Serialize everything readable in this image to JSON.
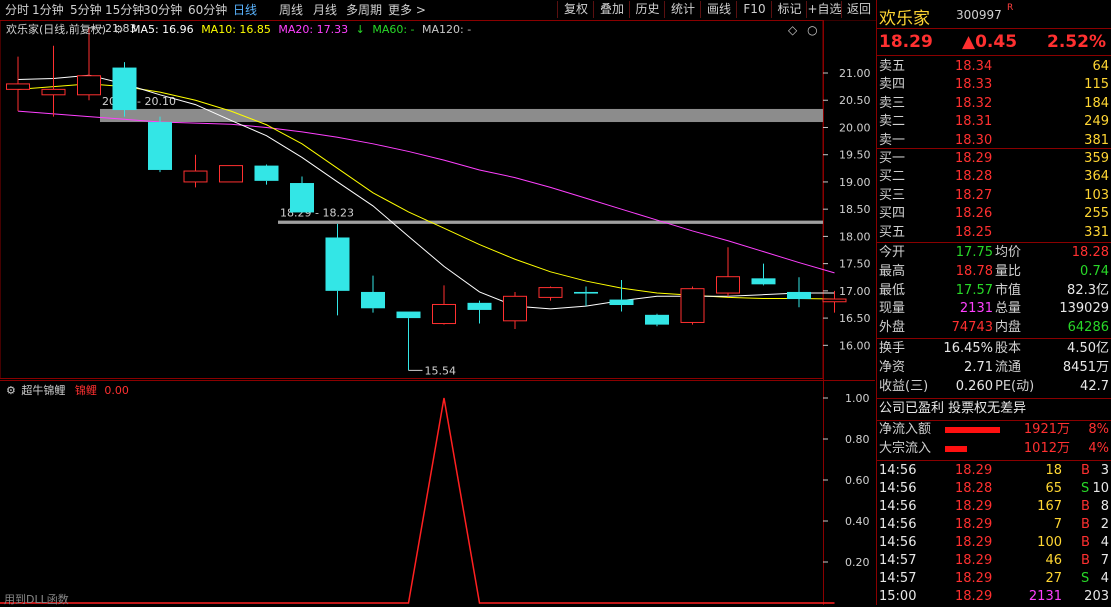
{
  "toolbar": {
    "periods": [
      "分时",
      "1分钟",
      "5分钟",
      "15分钟",
      "30分钟",
      "60分钟",
      "日线",
      "周线",
      "月线",
      "多周期",
      "更多 >"
    ],
    "active_index": 6,
    "actions": [
      "复权",
      "叠加",
      "历史",
      "统计",
      "画线",
      "F10",
      "标记",
      "+自选",
      "返回"
    ]
  },
  "header": {
    "stock_label": "欢乐家(日线,前复权)",
    "ma5": "MA5: 16.96",
    "ma10": "MA10: 16.85",
    "ma20": "MA20: 17.33",
    "ma60": "MA60: -",
    "ma120": "MA120: -",
    "colors": {
      "ma5": "#ffffff",
      "ma10": "#ffff00",
      "ma20": "#ff40ff",
      "ma60": "#28d828",
      "ma120": "#c8c8c8"
    }
  },
  "indicator": {
    "name": "超牛锦鲤",
    "series_label": "锦鲤",
    "value": "0.00",
    "footer": "用到DLL函数"
  },
  "chart_data": [
    {
      "type": "candlestick",
      "y_axis_ticks": [
        21.0,
        20.5,
        20.0,
        19.5,
        19.0,
        18.5,
        18.0,
        17.5,
        17.0,
        16.5,
        16.0
      ],
      "ylim": [
        15.4,
        21.9
      ],
      "candles": [
        {
          "o": 20.7,
          "c": 20.8,
          "h": 21.3,
          "l": 20.3
        },
        {
          "o": 20.6,
          "c": 20.7,
          "h": 21.5,
          "l": 20.2
        },
        {
          "o": 20.6,
          "c": 20.95,
          "h": 21.83,
          "l": 20.5
        },
        {
          "o": 21.1,
          "c": 20.32,
          "h": 21.2,
          "l": 20.2
        },
        {
          "o": 20.1,
          "c": 19.22,
          "h": 20.2,
          "l": 19.18
        },
        {
          "o": 19.0,
          "c": 19.2,
          "h": 19.5,
          "l": 18.9
        },
        {
          "o": 19.0,
          "c": 19.3,
          "h": 19.3,
          "l": 19.0
        },
        {
          "o": 19.3,
          "c": 19.02,
          "h": 19.32,
          "l": 18.95
        },
        {
          "o": 18.98,
          "c": 18.44,
          "h": 19.1,
          "l": 18.44
        },
        {
          "o": 17.98,
          "c": 17.0,
          "h": 18.23,
          "l": 16.55
        },
        {
          "o": 16.98,
          "c": 16.68,
          "h": 17.28,
          "l": 16.6
        },
        {
          "o": 16.62,
          "c": 16.5,
          "h": 16.62,
          "l": 15.54
        },
        {
          "o": 16.4,
          "c": 16.75,
          "h": 17.1,
          "l": 16.38
        },
        {
          "o": 16.78,
          "c": 16.65,
          "h": 16.82,
          "l": 16.4
        },
        {
          "o": 16.45,
          "c": 16.9,
          "h": 16.98,
          "l": 16.3
        },
        {
          "o": 16.88,
          "c": 17.06,
          "h": 17.08,
          "l": 16.82
        },
        {
          "o": 16.98,
          "c": 16.95,
          "h": 17.08,
          "l": 16.72
        },
        {
          "o": 16.84,
          "c": 16.74,
          "h": 17.2,
          "l": 16.62
        },
        {
          "o": 16.56,
          "c": 16.38,
          "h": 16.58,
          "l": 16.35
        },
        {
          "o": 16.42,
          "c": 17.04,
          "h": 17.08,
          "l": 16.38
        },
        {
          "o": 16.96,
          "c": 17.26,
          "h": 17.8,
          "l": 16.9
        },
        {
          "o": 17.23,
          "c": 17.12,
          "h": 17.5,
          "l": 17.1
        },
        {
          "o": 16.98,
          "c": 16.85,
          "h": 17.25,
          "l": 16.7
        },
        {
          "o": 16.8,
          "c": 16.85,
          "h": 17.0,
          "l": 16.6
        }
      ],
      "ma5": [
        20.88,
        20.9,
        20.96,
        20.8,
        20.6,
        20.42,
        20.13,
        19.85,
        19.45,
        19.0,
        18.56,
        18.0,
        17.45,
        16.98,
        16.72,
        16.67,
        16.72,
        16.82,
        16.9,
        16.9,
        16.9,
        16.93,
        16.96,
        16.96
      ],
      "ma10": [
        20.7,
        20.75,
        20.8,
        20.75,
        20.65,
        20.5,
        20.3,
        20.05,
        19.7,
        19.25,
        18.8,
        18.45,
        18.15,
        17.85,
        17.58,
        17.35,
        17.18,
        17.05,
        16.96,
        16.92,
        16.88,
        16.86,
        16.86,
        16.85
      ],
      "ma20": [
        20.3,
        20.25,
        20.2,
        20.15,
        20.1,
        20.08,
        20.06,
        20.0,
        19.92,
        19.82,
        19.7,
        19.56,
        19.4,
        19.22,
        19.08,
        18.9,
        18.7,
        18.5,
        18.3,
        18.1,
        17.92,
        17.72,
        17.52,
        17.33
      ],
      "price_levels": [
        {
          "label": "20.34 - 20.10",
          "low": 20.1,
          "high": 20.34
        },
        {
          "label": "18.29 - 18.23",
          "low": 18.23,
          "high": 18.29
        }
      ],
      "annotations": {
        "high": "21.83",
        "low": "15.54"
      }
    },
    {
      "type": "line",
      "y_axis_ticks": [
        1.0,
        0.8,
        0.6,
        0.4,
        0.2
      ],
      "ylim": [
        0,
        1
      ],
      "values": [
        0,
        0,
        0,
        0,
        0,
        0,
        0,
        0,
        0,
        0,
        0,
        0,
        1,
        0,
        0,
        0,
        0,
        0,
        0,
        0,
        0,
        0,
        0,
        0
      ]
    }
  ],
  "quote": {
    "name": "欢乐家",
    "code": "300997",
    "flag": "R",
    "price": "18.29",
    "change": "▲0.45",
    "pct": "2.52%",
    "asks": [
      {
        "label": "卖五",
        "price": "18.34",
        "vol": "64"
      },
      {
        "label": "卖四",
        "price": "18.33",
        "vol": "115"
      },
      {
        "label": "卖三",
        "price": "18.32",
        "vol": "184"
      },
      {
        "label": "卖二",
        "price": "18.31",
        "vol": "249"
      },
      {
        "label": "卖一",
        "price": "18.30",
        "vol": "381"
      }
    ],
    "bids": [
      {
        "label": "买一",
        "price": "18.29",
        "vol": "359"
      },
      {
        "label": "买二",
        "price": "18.28",
        "vol": "364"
      },
      {
        "label": "买三",
        "price": "18.27",
        "vol": "103"
      },
      {
        "label": "买四",
        "price": "18.26",
        "vol": "255"
      },
      {
        "label": "买五",
        "price": "18.25",
        "vol": "331"
      }
    ],
    "stats": [
      {
        "l1": "今开",
        "v1": "17.75",
        "c1": "green",
        "l2": "均价",
        "v2": "18.28",
        "c2": "red"
      },
      {
        "l1": "最高",
        "v1": "18.78",
        "c1": "red",
        "l2": "量比",
        "v2": "0.74",
        "c2": "green"
      },
      {
        "l1": "最低",
        "v1": "17.57",
        "c1": "green",
        "l2": "市值",
        "v2": "82.3亿",
        "c2": "white"
      },
      {
        "l1": "现量",
        "v1": "2131",
        "c1": "magenta",
        "l2": "总量",
        "v2": "139029",
        "c2": "white"
      },
      {
        "l1": "外盘",
        "v1": "74743",
        "c1": "red",
        "l2": "内盘",
        "v2": "64286",
        "c2": "green"
      }
    ],
    "fund": [
      {
        "l1": "换手",
        "v1": "16.45%",
        "l2": "股本",
        "v2": "4.50亿"
      },
      {
        "l1": "净资",
        "v1": "2.71",
        "l2": "流通",
        "v2": "8451万"
      },
      {
        "l1": "收益(三)",
        "v1": "0.260",
        "l2": "PE(动)",
        "v2": "42.7"
      }
    ],
    "note": "公司已盈利 投票权无差异",
    "flows": [
      {
        "label": "净流入额",
        "amount": "1921万",
        "pct": "8%",
        "bar": 0.55
      },
      {
        "label": "大宗流入",
        "amount": "1012万",
        "pct": "4%",
        "bar": 0.22
      }
    ],
    "ticks": [
      {
        "time": "14:56",
        "price": "18.29",
        "vol": "18",
        "side": "B",
        "n": "3"
      },
      {
        "time": "14:56",
        "price": "18.28",
        "vol": "65",
        "side": "S",
        "n": "10"
      },
      {
        "time": "14:56",
        "price": "18.29",
        "vol": "167",
        "side": "B",
        "n": "8"
      },
      {
        "time": "14:56",
        "price": "18.29",
        "vol": "7",
        "side": "B",
        "n": "2"
      },
      {
        "time": "14:56",
        "price": "18.29",
        "vol": "100",
        "side": "B",
        "n": "4"
      },
      {
        "time": "14:57",
        "price": "18.29",
        "vol": "46",
        "side": "B",
        "n": "7"
      },
      {
        "time": "14:57",
        "price": "18.29",
        "vol": "27",
        "side": "S",
        "n": "4"
      },
      {
        "time": "15:00",
        "price": "18.29",
        "vol": "2131",
        "side": "",
        "n": "203"
      }
    ]
  }
}
